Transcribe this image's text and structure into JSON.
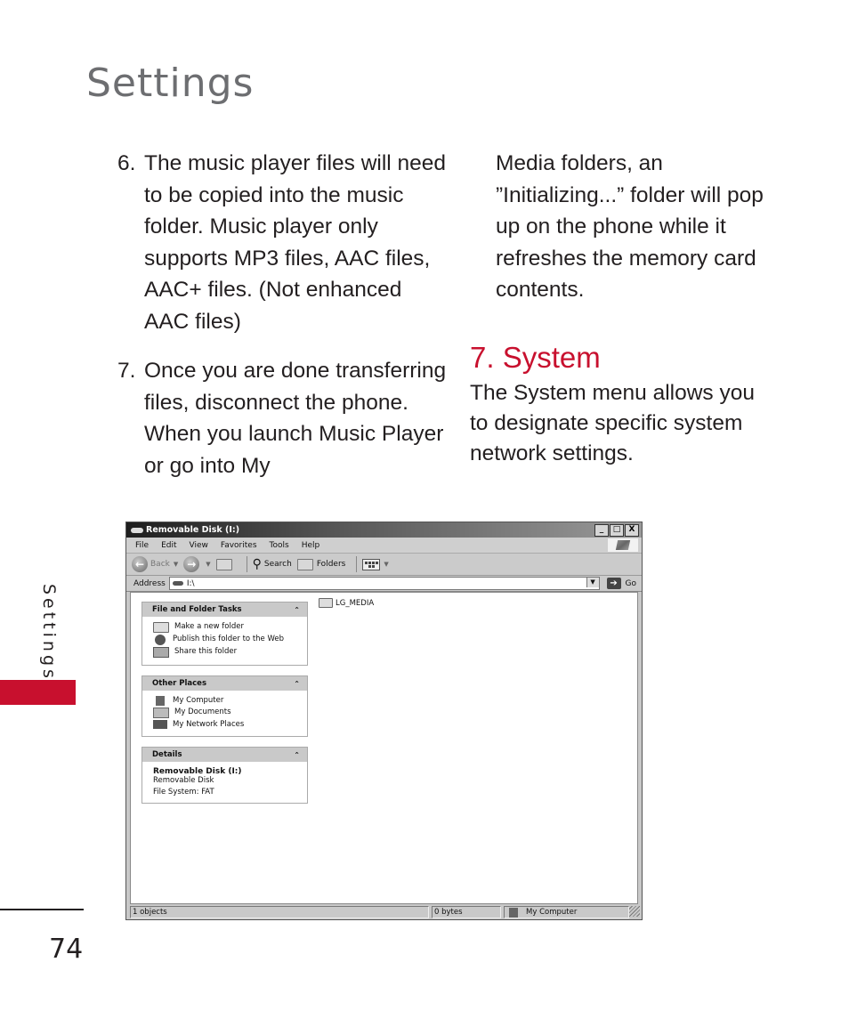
{
  "page": {
    "title": "Settings",
    "side_tab": "Settings",
    "page_number": "74",
    "accent_color": "#c8102e"
  },
  "left_column": {
    "items": [
      {
        "number": "6.",
        "text": "The music player files will need to be copied into the music folder. Music player only supports MP3 files, AAC files, AAC+ files. (Not enhanced AAC files)"
      },
      {
        "number": "7.",
        "text": "Once you are done transferring files, disconnect the phone. When you launch Music Player or go into My"
      }
    ]
  },
  "right_column": {
    "continuation": "Media folders, an ”Initializing...” folder will pop up on the phone while it refreshes the memory card contents.",
    "section_heading": "7. System",
    "section_body": "The System menu allows you to designate specific system network settings."
  },
  "explorer": {
    "title": "Removable Disk (I:)",
    "window_buttons": {
      "minimize": "_",
      "maximize": "□",
      "close": "X"
    },
    "menu": [
      "File",
      "Edit",
      "View",
      "Favorites",
      "Tools",
      "Help"
    ],
    "toolbar": {
      "back": "Back",
      "search": "Search",
      "folders": "Folders"
    },
    "address": {
      "label": "Address",
      "value": "I:\\",
      "go": "Go"
    },
    "panels": {
      "tasks": {
        "title": "File and Folder Tasks",
        "items": [
          "Make a new folder",
          "Publish this folder to the Web",
          "Share this folder"
        ]
      },
      "other_places": {
        "title": "Other Places",
        "items": [
          "My Computer",
          "My Documents",
          "My Network Places"
        ]
      },
      "details": {
        "title": "Details",
        "name": "Removable Disk (I:)",
        "type": "Removable Disk",
        "file_system": "File System: FAT"
      },
      "collapse_glyph": "ˆ"
    },
    "files": [
      {
        "name": "LG_MEDIA"
      }
    ],
    "status": {
      "objects": "1 objects",
      "size": "0 bytes",
      "location": "My Computer"
    }
  }
}
